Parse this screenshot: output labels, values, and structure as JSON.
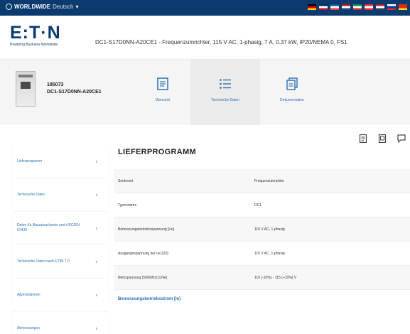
{
  "topbar": {
    "region": "WORLDWIDE",
    "language": "Deutsch",
    "flags": [
      {
        "name": "flag-de",
        "colors": [
          "#000000",
          "#dd0000",
          "#ffce00"
        ]
      },
      {
        "name": "flag-uk",
        "colors": [
          "#012169",
          "#ffffff",
          "#c8102e"
        ]
      },
      {
        "name": "flag-fr",
        "colors": [
          "#0055a4",
          "#ffffff",
          "#ef4135"
        ]
      },
      {
        "name": "flag-nl",
        "colors": [
          "#ae1c28",
          "#ffffff",
          "#21468b"
        ]
      },
      {
        "name": "flag-it",
        "colors": [
          "#009246",
          "#ffffff",
          "#ce2b37"
        ]
      },
      {
        "name": "flag-at",
        "colors": [
          "#ed2939",
          "#ffffff",
          "#ed2939"
        ]
      },
      {
        "name": "flag-us",
        "colors": [
          "#b22234",
          "#ffffff",
          "#3c3b6e"
        ]
      },
      {
        "name": "flag-ru",
        "colors": [
          "#ffffff",
          "#0039a6",
          "#d52b1e"
        ]
      },
      {
        "name": "flag-cn",
        "colors": [
          "#de2910",
          "#de2910",
          "#ffde00"
        ]
      }
    ]
  },
  "header": {
    "logo_text": "E:T·N",
    "logo_tagline": "Powering Business Worldwide",
    "title": "DC1-S17D0NN-A20CE1 - Frequenzumrichter, 115 V AC, 1-phasig, 7 A, 0.37 kW, IP20/NEMA 0, FS1"
  },
  "product": {
    "id": "185073",
    "name": "DC1-S17D0NN-A20CE1"
  },
  "tabs": [
    {
      "label": "Übersicht",
      "icon": "document-icon"
    },
    {
      "label": "Technische Daten",
      "icon": "list-icon"
    },
    {
      "label": "Dokumentation",
      "icon": "documents-icon"
    }
  ],
  "actions": [
    {
      "name": "pdf-icon"
    },
    {
      "name": "print-icon"
    },
    {
      "name": "chat-icon"
    }
  ],
  "sidebar": {
    "items": [
      {
        "label": "Lieferprogramm"
      },
      {
        "label": "Technische Daten"
      },
      {
        "label": "Daten für Bauartnachweis nach IEC/EN 61439"
      },
      {
        "label": "Technische Daten nach ETIM 7.0"
      },
      {
        "label": "Approbationen"
      },
      {
        "label": "Abmessungen"
      }
    ]
  },
  "main": {
    "section_title": "LIEFERPROGRAMM",
    "rows": [
      {
        "key": "Sortiment",
        "value": "Frequenzumrichter"
      },
      {
        "key": "Typenname",
        "value": "DC1"
      },
      {
        "key": "Bemessungsbetriebsspannung [Ue]",
        "value": "115 V AC, 1-phasig"
      },
      {
        "key": "Ausgangsspannung bei Ue [U2]",
        "value": "115 V AC, 1-phasig"
      },
      {
        "key": "Netzspannung (50/60Hz) [LNe]",
        "value": "110 (-10%) - 115 (+10%) V"
      }
    ],
    "subheading": "Bemessungsbetriebsstrom [Ie]"
  },
  "colors": {
    "topbar": "#0a3a6e",
    "brand": "#0a3a6e",
    "link": "#2a6fb3"
  }
}
